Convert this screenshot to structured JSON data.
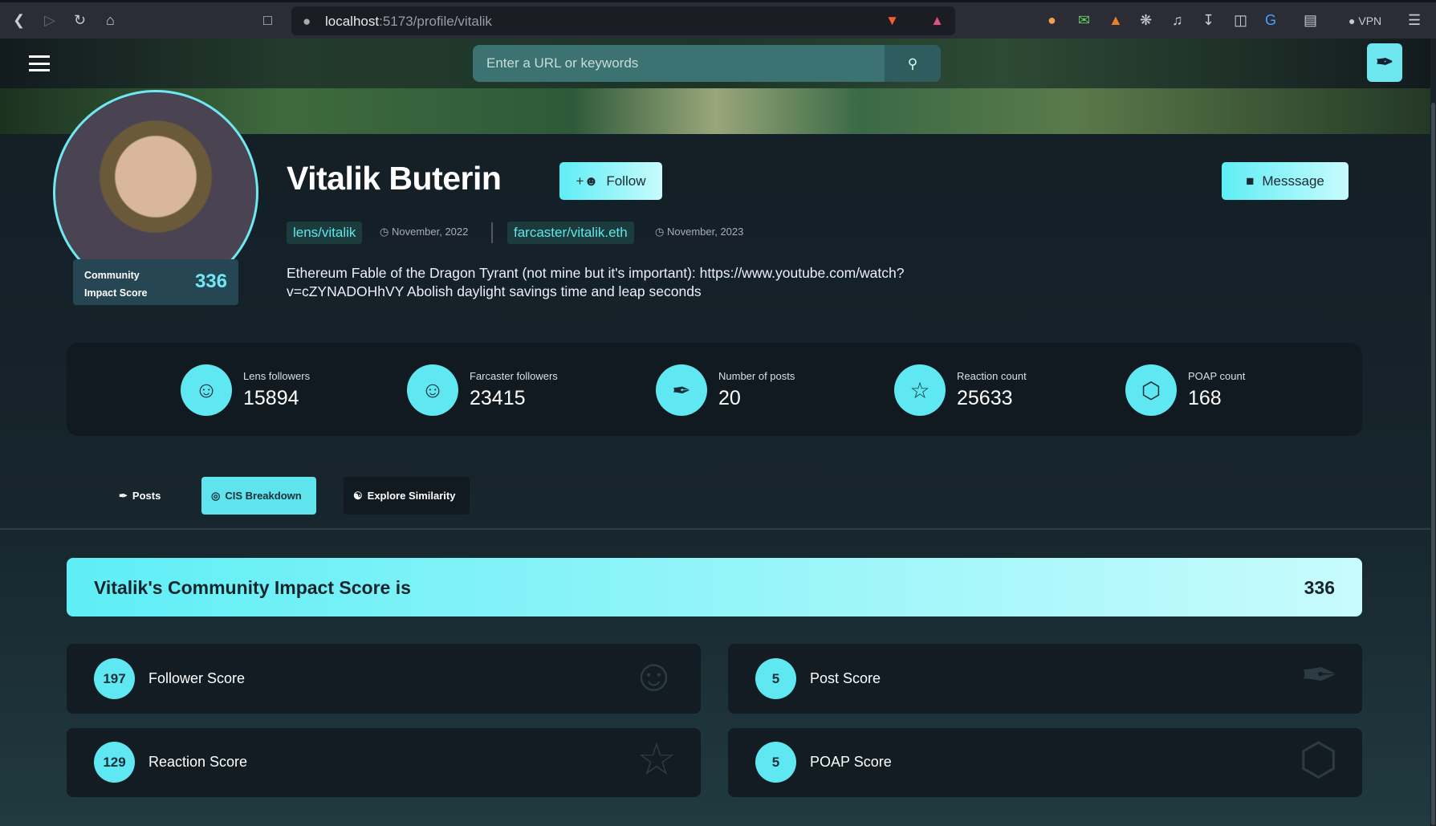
{
  "browser": {
    "url_host": "localhost",
    "url_path": ":5173/profile/vitalik",
    "vpn": "VPN"
  },
  "header": {
    "search_placeholder": "Enter a URL or keywords"
  },
  "profile": {
    "name": "Vitalik Buterin",
    "follow_label": "Follow",
    "message_label": "Messsage",
    "cis_label_1": "Community",
    "cis_label_2": "Impact Score",
    "cis_value": "336",
    "lens_handle": "lens/vitalik",
    "lens_date": "November, 2022",
    "farcaster_handle": "farcaster/vitalik.eth",
    "farcaster_date": "November, 2023",
    "bio": "Ethereum Fable of the Dragon Tyrant (not mine but it's important): https://www.youtube.com/watch?v=cZYNADOHhVY Abolish daylight savings time and leap seconds"
  },
  "stats": [
    {
      "label": "Lens followers",
      "value": "15894",
      "icon": "users-icon"
    },
    {
      "label": "Farcaster followers",
      "value": "23415",
      "icon": "users-icon"
    },
    {
      "label": "Number of posts",
      "value": "20",
      "icon": "feather-icon"
    },
    {
      "label": "Reaction count",
      "value": "25633",
      "icon": "star-icon"
    },
    {
      "label": "POAP count",
      "value": "168",
      "icon": "hexagon-icon"
    }
  ],
  "tabs": [
    {
      "label": "Posts"
    },
    {
      "label": "CIS Breakdown",
      "active": true
    },
    {
      "label": "Explore Similarity"
    }
  ],
  "breakdown": {
    "title": "Vitalik's Community Impact Score is",
    "total": "336",
    "cards": [
      {
        "value": "197",
        "label": "Follower Score",
        "icon": "users-icon"
      },
      {
        "value": "5",
        "label": "Post Score",
        "icon": "feather-icon"
      },
      {
        "value": "129",
        "label": "Reaction Score",
        "icon": "star-icon"
      },
      {
        "value": "5",
        "label": "POAP Score",
        "icon": "hexagon-icon"
      }
    ]
  },
  "colors": {
    "accent": "#5fe8f2",
    "background": "#17252b",
    "panel": "#121c22"
  }
}
